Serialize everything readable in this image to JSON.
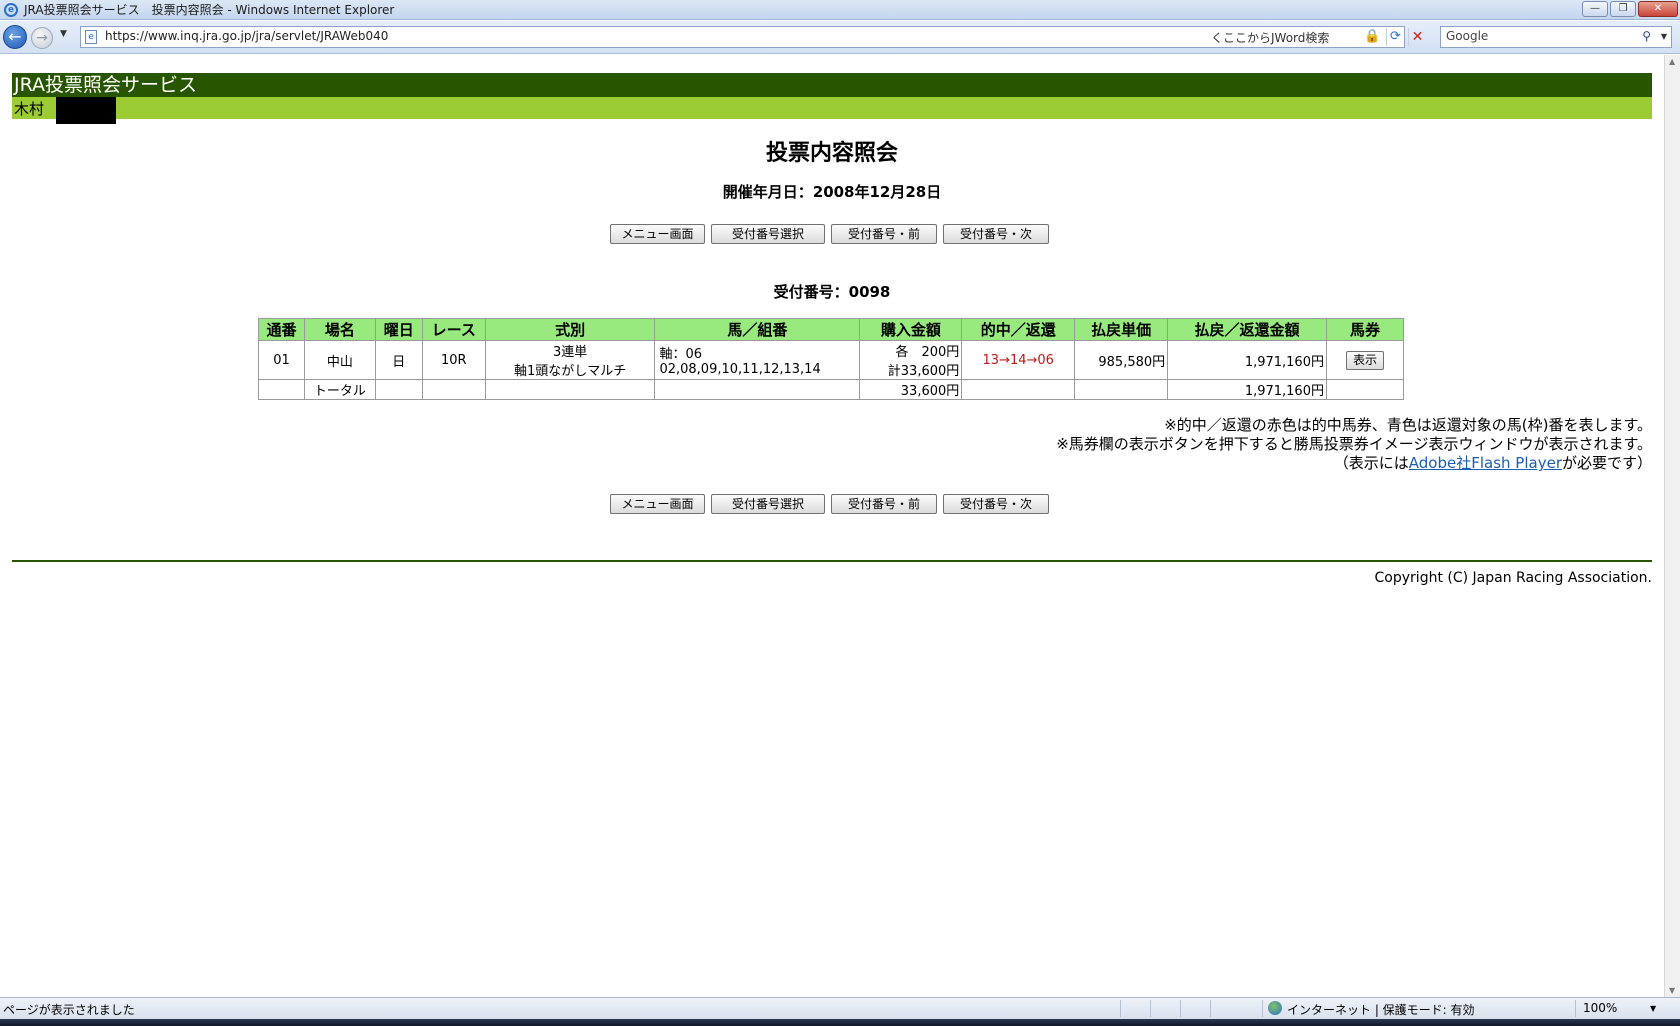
{
  "window": {
    "title": "JRA投票照会サービス　投票内容照会 - Windows Internet Explorer",
    "controls": {
      "minimize": "—",
      "restore": "❐",
      "close": "✕"
    }
  },
  "browser": {
    "url": "https://www.inq.jra.go.jp/jra/servlet/JRAWeb040",
    "jword": "くここからJWord検索",
    "search_value": "Google"
  },
  "header": {
    "service_name": "JRA投票照会サービス",
    "user_name": "木村"
  },
  "page": {
    "title": "投票内容照会",
    "date_line": "開催年月日：2008年12月28日",
    "receipt_number": "受付番号：0098"
  },
  "buttons": {
    "menu": "メニュー画面",
    "select": "受付番号選択",
    "prev": "受付番号・前",
    "next": "受付番号・次"
  },
  "table": {
    "headers": [
      "通番",
      "場名",
      "曜日",
      "レース",
      "式別",
      "馬／組番",
      "購入金額",
      "的中／返還",
      "払戻単価",
      "払戻／返還金額",
      "馬券"
    ],
    "row": {
      "serial": "01",
      "venue": "中山",
      "day": "日",
      "race": "10R",
      "bet_type_1": "3連単",
      "bet_type_2": "軸1頭ながしマルチ",
      "combo_1": "軸：06",
      "combo_2": "02,08,09,10,11,12,13,14",
      "amount_1": "各　200円",
      "amount_2": "計33,600円",
      "hit": "13→14→06",
      "unit_payout": "985,580円",
      "total_payout": "1,971,160円",
      "ticket_button": "表示"
    },
    "total": {
      "label": "トータル",
      "amount": "33,600円",
      "payout": "1,971,160円"
    }
  },
  "notes": {
    "line1": "※的中／返還の赤色は的中馬券、青色は返還対象の馬(枠)番を表します。",
    "line2": "※馬券欄の表示ボタンを押下すると勝馬投票券イメージ表示ウィンドウが表示されます。",
    "line3_pre": "（表示には",
    "line3_link": "Adobe社Flash Player",
    "line3_post": "が必要です）"
  },
  "footer": {
    "copyright": "Copyright (C) Japan Racing Association."
  },
  "status": {
    "left": "ページが表示されました",
    "zone": "インターネット | 保護モード: 有効",
    "zoom": "100%"
  }
}
